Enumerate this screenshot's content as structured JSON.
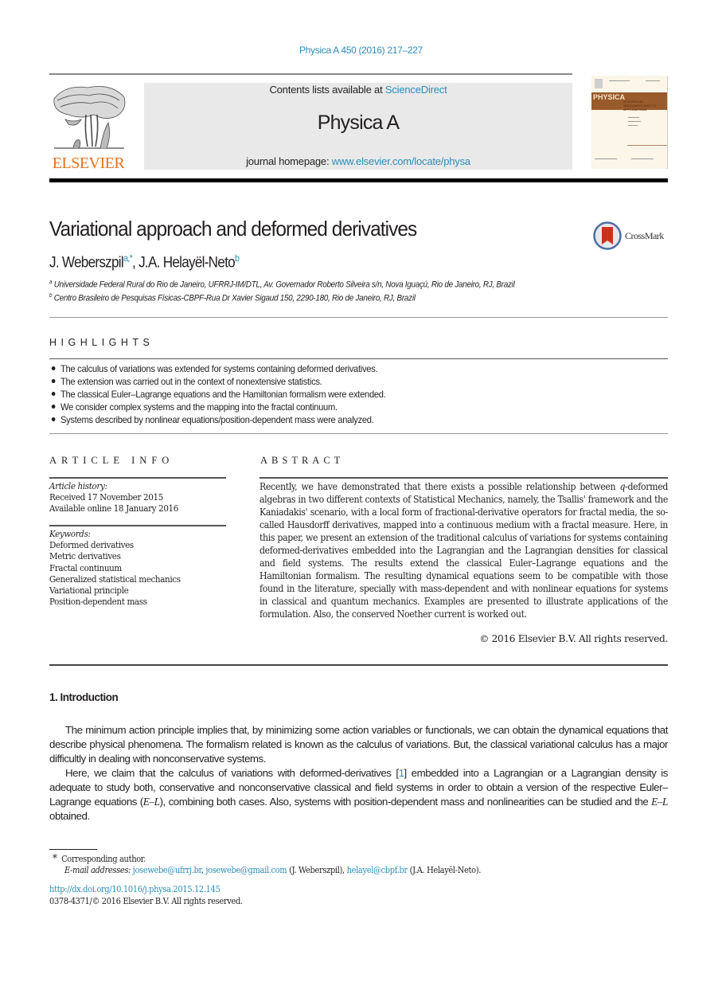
{
  "header": {
    "journal_ref": "Physica A 450 (2016) 217–227",
    "contents_prefix": "Contents lists available at ",
    "contents_link": "ScienceDirect",
    "journal_name": "Physica A",
    "homepage_prefix": "journal homepage: ",
    "homepage_link": "www.elsevier.com/locate/physa",
    "publisher_logo_text": "ELSEVIER",
    "cover": {
      "title": "PHYSICA",
      "subtitle": "STATISTICAL MECHANICS AND ITS APPLICATIONS"
    }
  },
  "article": {
    "title": "Variational approach and deformed derivatives",
    "crossmark_label": "CrossMark",
    "authors": [
      {
        "name": "J. Weberszpil",
        "sup": "a,*"
      },
      {
        "name": "J.A. Helayël-Neto",
        "sup": "b"
      }
    ],
    "author_separator": ", ",
    "affiliations": [
      {
        "sup": "a",
        "text": "Universidade Federal Rural do Rio de Janeiro, UFRRJ-IM/DTL, Av. Governador Roberto Silveira s/n, Nova Iguaçú, Rio de Janeiro, RJ, Brazil"
      },
      {
        "sup": "b",
        "text": "Centro Brasileiro de Pesquisas Físicas-CBPF-Rua Dr Xavier Sigaud 150, 2290-180, Rio de Janeiro, RJ, Brazil"
      }
    ]
  },
  "highlights": {
    "title": "HIGHLIGHTS",
    "items": [
      "The calculus of variations was extended for systems containing deformed derivatives.",
      "The extension was carried out in the context of nonextensive statistics.",
      "The classical Euler–Lagrange equations and the Hamiltonian formalism were extended.",
      "We consider complex systems and the mapping into the fractal continuum.",
      "Systems described by nonlinear equations/position-dependent mass were analyzed."
    ]
  },
  "article_info": {
    "title": "ARTICLE INFO",
    "history_label": "Article history:",
    "received": "Received 17 November 2015",
    "available": "Available online 18 January 2016",
    "keywords_label": "Keywords:",
    "keywords": [
      "Deformed derivatives",
      "Metric derivatives",
      "Fractal continuum",
      "Generalized statistical mechanics",
      "Variational principle",
      "Position-dependent mass"
    ]
  },
  "abstract": {
    "title": "ABSTRACT",
    "text_before_q": "Recently, we have demonstrated that there exists a possible relationship between ",
    "q": "q",
    "text_after_q": "-deformed algebras in two different contexts of Statistical Mechanics, namely, the Tsallis' framework and the Kaniadakis' scenario, with a local form of fractional-derivative operators for fractal media, the so-called Hausdorff derivatives, mapped into a continuous medium with a fractal measure. Here, in this paper, we present an extension of the traditional calculus of variations for systems containing deformed-derivatives embedded into the Lagrangian and the Lagrangian densities for classical and field systems. The results extend the classical Euler–Lagrange equations and the Hamiltonian formalism. The resulting dynamical equations seem to be compatible with those found in the literature, specially with mass-dependent and with nonlinear equations for systems in classical and quantum mechanics. Examples are presented to illustrate applications of the formulation. Also, the conserved  Noether current is worked out.",
    "copyright": "© 2016 Elsevier B.V. All rights reserved."
  },
  "introduction": {
    "heading": "1.  Introduction",
    "para1": "The minimum action principle implies that, by minimizing some action variables or functionals, we can obtain the dynamical equations that describe physical phenomena. The formalism related is known as the calculus of variations. But, the classical variational calculus has a major difficultly in dealing with nonconservative systems.",
    "para2_a": "Here, we claim that the calculus of variations with deformed-derivatives [",
    "para2_ref": "1",
    "para2_b": "] embedded into a Lagrangian or a Lagrangian density is adequate to study both, conservative and nonconservative classical and field systems in order to obtain a version of the respective Euler–Lagrange equations (",
    "para2_el1": "E–L",
    "para2_c": "), combining both cases. Also, systems with position-dependent mass and nonlinearities can be studied and the ",
    "para2_el2": "E–L",
    "para2_d": " obtained."
  },
  "footnotes": {
    "star": "*",
    "corresponding": "Corresponding author.",
    "email_label": "E-mail addresses:",
    "email1": "josewebe@ufrrj.br",
    "sep1": ", ",
    "email2": "josewebe@gmail.com",
    "owner1": " (J. Weberszpil), ",
    "email3": "helayel@cbpf.br",
    "owner2": " (J.A. Helayël-Neto).",
    "doi": "http://dx.doi.org/10.1016/j.physa.2015.12.145",
    "issn_copyright": "0378-4371/© 2016 Elsevier B.V. All rights reserved."
  }
}
